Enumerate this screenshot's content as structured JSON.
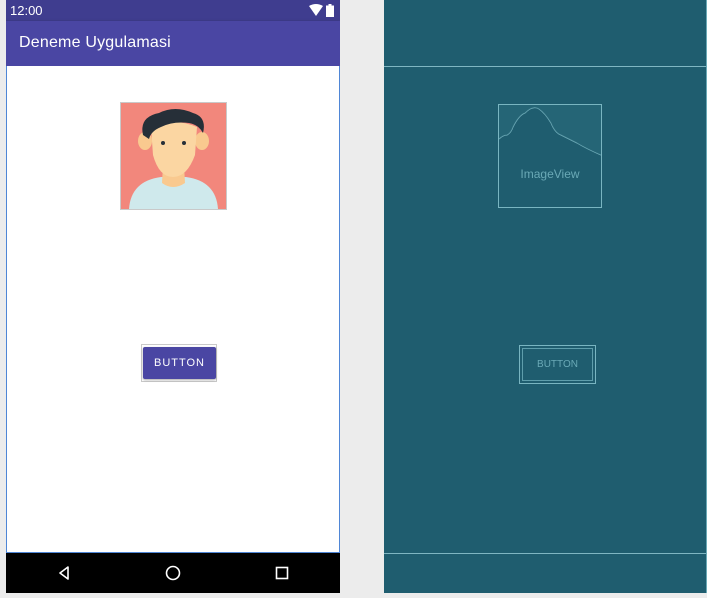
{
  "status_bar": {
    "time": "12:00",
    "icons": [
      "wifi-icon",
      "battery-icon"
    ]
  },
  "app_bar": {
    "title": "Deneme Uygulamasi"
  },
  "content": {
    "image": {
      "icon": "avatar-icon"
    },
    "button": {
      "label": "BUTTON"
    }
  },
  "nav_bar": {
    "icons": [
      "back-icon",
      "home-icon",
      "recents-icon"
    ]
  },
  "blueprint": {
    "image_label": "ImageView",
    "button_label": "BUTTON"
  },
  "colors": {
    "primary": "#4a46a3",
    "primary_dark": "#3f3d8f",
    "avatar_bg": "#f2877c",
    "blueprint_bg": "#1f5d6f",
    "blueprint_line": "#79b5c1"
  }
}
